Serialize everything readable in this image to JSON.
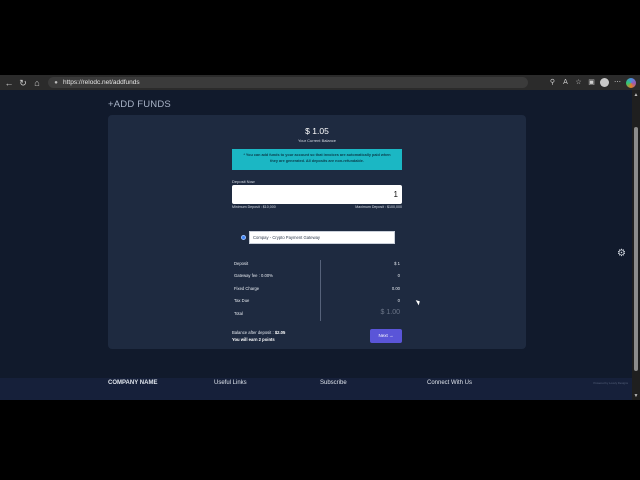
{
  "browser": {
    "url": "https://relodc.net/addfunds",
    "icons": [
      "back-icon",
      "refresh-icon",
      "home-icon",
      "lock-icon",
      "zoom-icon",
      "read-aloud-icon",
      "favorite-icon",
      "collections-icon",
      "profile-avatar",
      "more-icon",
      "copilot-icon"
    ]
  },
  "page": {
    "title": "+ADD FUNDS",
    "balance": {
      "amount": "$ 1.05",
      "label": "Your Current Balance"
    },
    "notice": "* You can add funds to your account so that invoices are automatically paid when they are generated. All deposits are non-refundable.",
    "deposit": {
      "label": "Deposit Now",
      "value": "1",
      "min": "Minimum Deposit : $10,000",
      "max": "Maximum Deposit : $100,000"
    },
    "gateway": {
      "label": "Compay - Crypto Payment Gateway",
      "selected": true
    },
    "summary": [
      {
        "key": "Deposit",
        "value": "$ 1"
      },
      {
        "key": "Gateway fee : 0.00%",
        "value": "0"
      },
      {
        "key": "Fixed Charge",
        "value": "0.00"
      },
      {
        "key": "Tax Due",
        "value": "0"
      },
      {
        "key": "Total",
        "value": "$ 1.00"
      }
    ],
    "after_deposit_label": "Balance after deposit :",
    "after_deposit_value": "$2.05",
    "earn_text": "You will earn 2 points",
    "next_label": "Next"
  },
  "footer": {
    "columns": [
      "COMPANY NAME",
      "Useful Links",
      "Subscribe",
      "Connect With Us"
    ],
    "credit": "Powered by Lovely Designs"
  },
  "colors": {
    "page_bg": "#111a2c",
    "card_bg": "#1e2a40",
    "notice_bg": "#1bb7c4",
    "button": "#5a55d8"
  }
}
